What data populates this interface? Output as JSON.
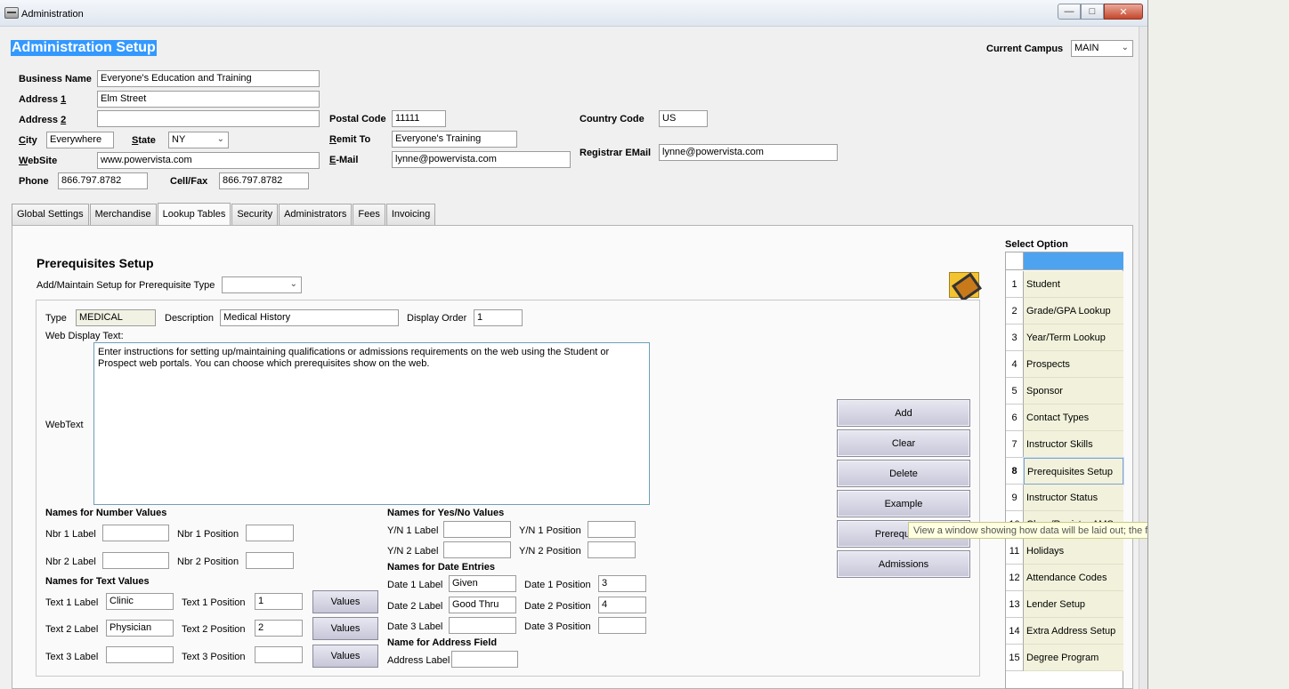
{
  "window": {
    "title": "Administration"
  },
  "header": {
    "page_title": "Administration Setup",
    "campus_label": "Current Campus",
    "campus_value": "MAIN"
  },
  "business": {
    "name_label": "Business Name",
    "name_value": "Everyone's Education and Training",
    "address1_label_pre": "Address ",
    "address1_label_u": "1",
    "address1_value": "Elm Street",
    "address2_label_pre": "Address ",
    "address2_label_u": "2",
    "address2_value": "",
    "city_label_u": "C",
    "city_label_rest": "ity",
    "city_value": "Everywhere",
    "state_label_u": "S",
    "state_label_rest": "tate",
    "state_value": "NY",
    "website_label_u": "W",
    "website_label_rest": "ebSite",
    "website_value": "www.powervista.com",
    "phone_label": "Phone",
    "phone_value": "866.797.8782",
    "cellfax_label": "Cell/Fax",
    "cellfax_value": "866.797.8782",
    "postal_label": "Postal Code",
    "postal_value": "11111",
    "remit_label_u": "R",
    "remit_label_rest": "emit To",
    "remit_value": "Everyone's Training",
    "email_label_u": "E",
    "email_label_rest": "-Mail",
    "email_value": "lynne@powervista.com",
    "country_label": "Country Code",
    "country_value": "US",
    "registrar_label": "Registrar EMail",
    "registrar_value": "lynne@powervista.com"
  },
  "tabs": [
    "Global Settings",
    "Merchandise",
    "Lookup Tables",
    "Security",
    "Administrators",
    "Fees",
    "Invoicing"
  ],
  "prereq": {
    "title": "Prerequisites Setup",
    "maintain_label": "Add/Maintain Setup for Prerequisite Type",
    "maintain_value": "",
    "type_label": "Type",
    "type_value": "MEDICAL",
    "description_label": "Description",
    "description_value": "Medical History",
    "display_order_label": "Display Order",
    "display_order_value": "1",
    "web_display_label": "Web Display Text:",
    "webtext_label": "WebText",
    "webtext_value": "Enter instructions for setting up/maintaining qualifications or admissions requirements on the web using the Student or Prospect web portals. You can choose which prerequisites show on the web.",
    "number_head": "Names for Number Values",
    "nbr1_label": "Nbr 1 Label",
    "nbr1_value": "",
    "nbr1_pos_label": "Nbr 1 Position",
    "nbr1_pos_value": "",
    "nbr2_label": "Nbr 2 Label",
    "nbr2_value": "",
    "nbr2_pos_label": "Nbr 2 Position",
    "nbr2_pos_value": "",
    "text_head": "Names for Text Values",
    "text1_label": "Text 1 Label",
    "text1_value": "Clinic",
    "text1_pos_label": "Text 1 Position",
    "text1_pos_value": "1",
    "text2_label": "Text 2 Label",
    "text2_value": "Physician",
    "text2_pos_label": "Text 2 Position",
    "text2_pos_value": "2",
    "text3_label": "Text 3 Label",
    "text3_value": "",
    "text3_pos_label": "Text 3 Position",
    "text3_pos_value": "",
    "values_button": "Values",
    "yn_head": "Names for Yes/No Values",
    "yn1_label": "Y/N 1 Label",
    "yn1_value": "",
    "yn1_pos_label": "Y/N 1 Position",
    "yn1_pos_value": "",
    "yn2_label": "Y/N 2 Label",
    "yn2_value": "",
    "yn2_pos_label": "Y/N 2 Position",
    "yn2_pos_value": "",
    "date_head": "Names for Date Entries",
    "date1_label": "Date 1 Label",
    "date1_value": "Given",
    "date1_pos_label": "Date 1 Position",
    "date1_pos_value": "3",
    "date2_label": "Date 2 Label",
    "date2_value": "Good Thru",
    "date2_pos_label": "Date 2 Position",
    "date2_pos_value": "4",
    "date3_label": "Date 3 Label",
    "date3_value": "",
    "date3_pos_label": "Date 3 Position",
    "date3_pos_value": "",
    "address_head": "Name for Address Field",
    "address_label": "Address Label",
    "address_value": ""
  },
  "actions": {
    "add": "Add",
    "clear": "Clear",
    "delete": "Delete",
    "example": "Example",
    "prerequisites": "Prerequisites",
    "admissions": "Admissions"
  },
  "tooltip": "View a window showing how data will be laid out; the first person will be shown",
  "select_option": {
    "title": "Select Option",
    "items": [
      {
        "num": "1",
        "label": "Student"
      },
      {
        "num": "2",
        "label": "Grade/GPA Lookup"
      },
      {
        "num": "3",
        "label": "Year/Term Lookup"
      },
      {
        "num": "4",
        "label": "Prospects"
      },
      {
        "num": "5",
        "label": "Sponsor"
      },
      {
        "num": "6",
        "label": "Contact Types"
      },
      {
        "num": "7",
        "label": "Instructor Skills"
      },
      {
        "num": "8",
        "label": "Prerequisites Setup"
      },
      {
        "num": "9",
        "label": "Instructor Status"
      },
      {
        "num": "10",
        "label": "Class/Register AMS"
      },
      {
        "num": "11",
        "label": "Holidays"
      },
      {
        "num": "12",
        "label": "Attendance Codes"
      },
      {
        "num": "13",
        "label": "Lender Setup"
      },
      {
        "num": "14",
        "label": "Extra Address Setup"
      },
      {
        "num": "15",
        "label": "Degree Program"
      }
    ],
    "selected_index": 7
  },
  "colors": {
    "title_highlight": "#3399ff",
    "option_bg": "#f2f2dc",
    "button_bg": "#d4d4e2"
  }
}
